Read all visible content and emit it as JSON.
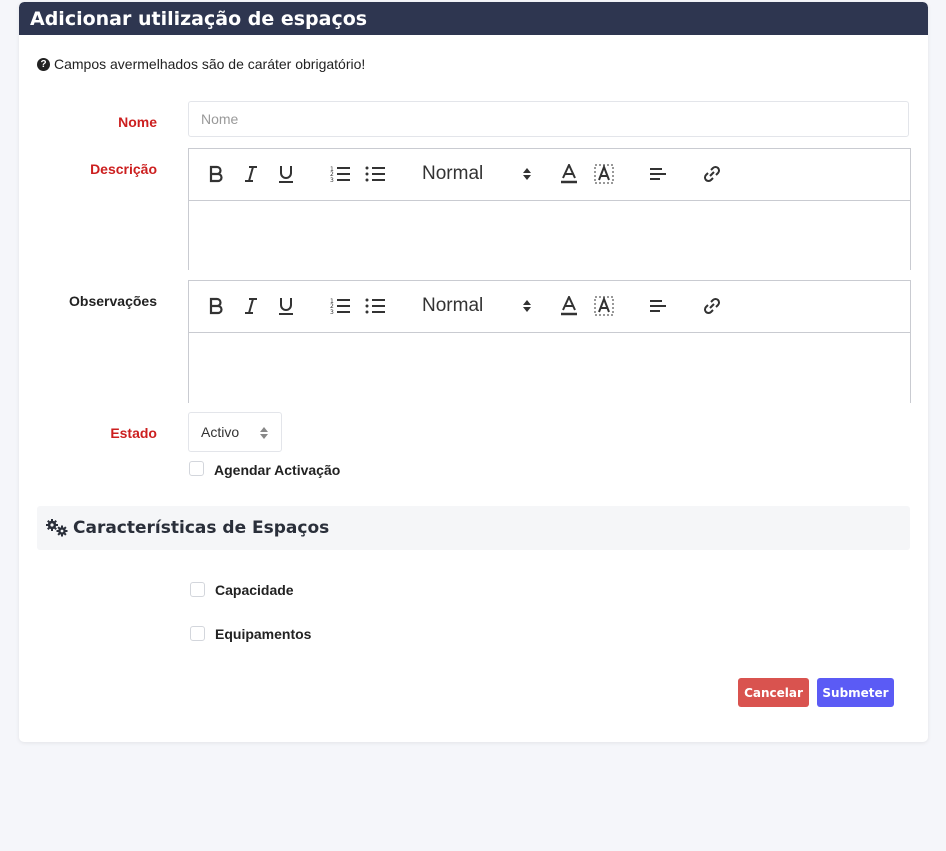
{
  "header": {
    "title": "Adicionar utilização de espaços"
  },
  "note": {
    "text": "Campos avermelhados são de caráter obrigatório!",
    "icon": "question-circle-icon"
  },
  "fields": {
    "nome": {
      "label": "Nome",
      "placeholder": "Nome",
      "value": ""
    },
    "descricao": {
      "label": "Descrição"
    },
    "observacoes": {
      "label": "Observações"
    },
    "estado": {
      "label": "Estado",
      "value": "Activo"
    }
  },
  "editor_toolbar": {
    "header_select": "Normal",
    "tools": [
      "bold-icon",
      "italic-icon",
      "underline-icon",
      "ordered-list-icon",
      "bullet-list-icon",
      "font-color-icon",
      "background-color-icon",
      "align-icon",
      "link-icon"
    ]
  },
  "agendar": {
    "label": "Agendar Activação",
    "checked": false
  },
  "section": {
    "title": "Características de Espaços",
    "icon": "cogs-icon"
  },
  "characteristics": [
    {
      "label": "Capacidade",
      "checked": false
    },
    {
      "label": "Equipamentos",
      "checked": false
    }
  ],
  "buttons": {
    "cancel": "Cancelar",
    "submit": "Submeter"
  },
  "colors": {
    "header_bg": "#2e3650",
    "required_label": "#cc1f1f",
    "cancel": "#d9534f",
    "submit": "#5b5bf5"
  }
}
